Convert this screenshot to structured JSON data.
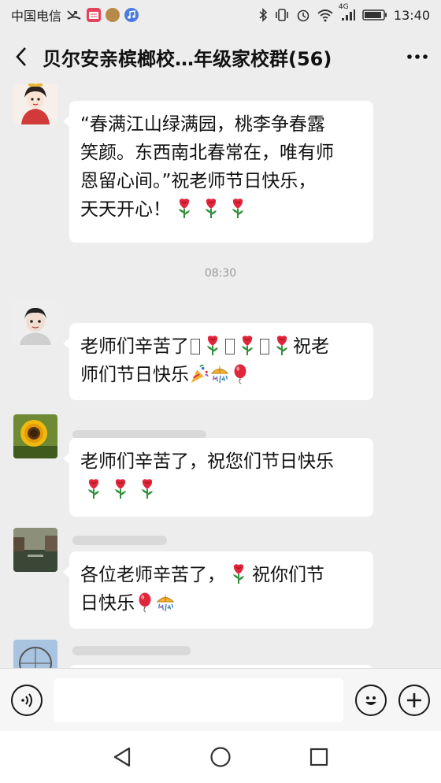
{
  "status_bar": {
    "carrier": "中国电信",
    "time": "13:40",
    "network": "4G"
  },
  "header": {
    "title": "贝尔安亲槟榔校…年级家校群(56)"
  },
  "messages": [
    {
      "lines": [
        "“春满江山绿满园，桃李争春露",
        "笑颜。东西南北春常在，唯有师",
        "恩留心间。”祝老师节日快乐，",
        "天天开心！"
      ]
    },
    {
      "time": "08:30"
    },
    {
      "line1": "老师们辛苦了",
      "line1b": "祝老",
      "line2": "师们节日快乐"
    },
    {
      "line1": "老师们辛苦了，祝您们节日快乐"
    },
    {
      "line1": "各位老师辛苦了，",
      "line1b": "祝你们节",
      "line2": "日快乐"
    }
  ],
  "icons": {
    "back": "chevron-left-icon",
    "more": "more-icon",
    "voice": "voice-icon",
    "emoji": "emoji-icon",
    "plus": "plus-icon",
    "nav_back": "nav-back-icon",
    "nav_home": "nav-home-icon",
    "nav_recent": "nav-recent-icon"
  },
  "colors": {
    "background": "#ededed",
    "bubble": "#ffffff",
    "rose": "#e0263a",
    "leaf": "#2f8f3a"
  }
}
